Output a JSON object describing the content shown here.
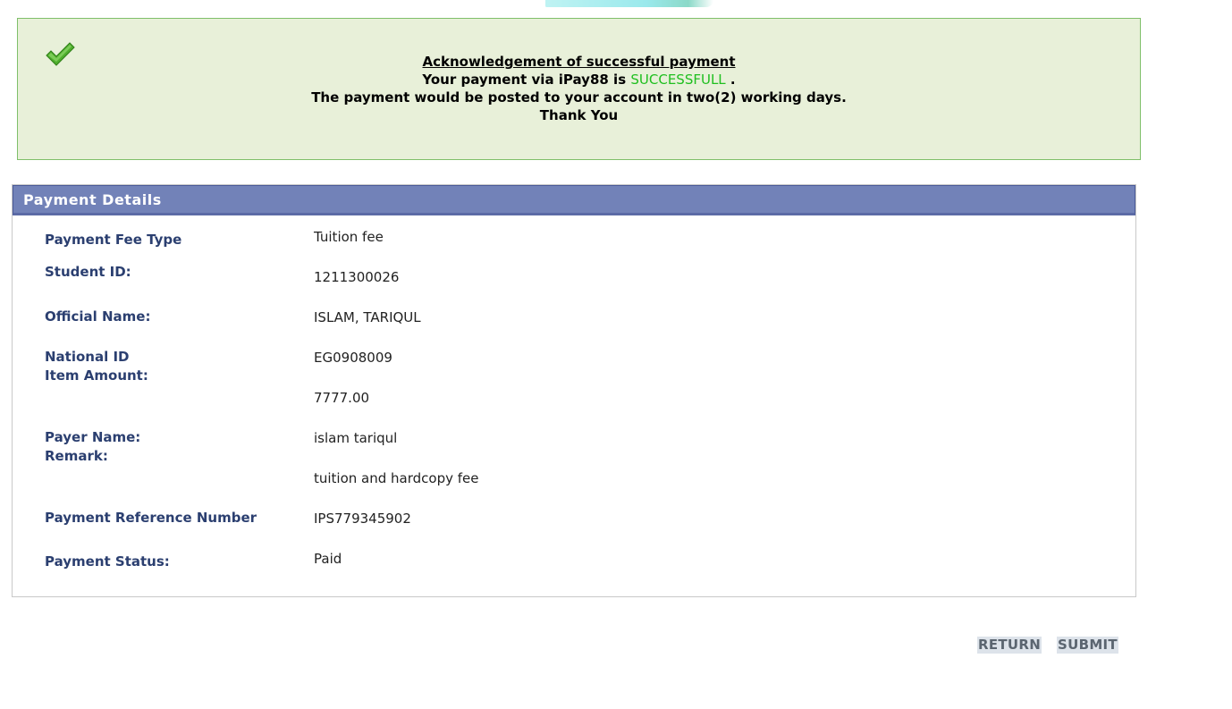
{
  "acknowledgement": {
    "title": "Acknowledgement of successful payment",
    "line1_prefix": "Your payment via iPay88 is",
    "status_word": "SUCCESSFULL",
    "line1_suffix": ".",
    "line2": "The payment would be posted to your account in two(2) working days.",
    "line3": "Thank You",
    "icon": "checkmark-icon",
    "status_color": "#1fbf1f"
  },
  "details": {
    "header": "Payment Details",
    "labels": {
      "fee_type": "Payment Fee Type",
      "student_id": "Student ID:",
      "official_name": "Official Name:",
      "national_id": "National ID",
      "item_amount": "Item Amount:",
      "payer_name": "Payer Name:",
      "remark": "Remark:",
      "reference": "Payment Reference Number",
      "status": "Payment Status:"
    },
    "values": {
      "fee_type": "Tuition fee",
      "student_id": "1211300026",
      "official_name": "ISLAM, TARIQUL",
      "national_id": "EG0908009",
      "item_amount": "7777.00",
      "payer_name": "islam tariqul",
      "remark": "tuition and hardcopy fee",
      "reference": "IPS779345902",
      "status": "Paid"
    }
  },
  "buttons": {
    "return": "RETURN",
    "submit": "SUBMIT"
  }
}
